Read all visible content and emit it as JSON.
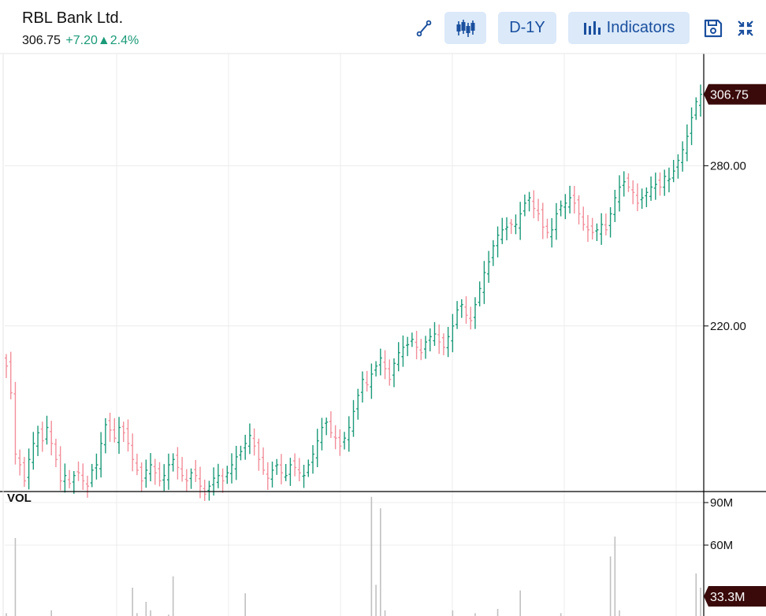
{
  "header": {
    "title": "RBL Bank Ltd.",
    "price": "306.75",
    "change": "+7.20",
    "change_pct": "2.4%",
    "change_arrow": "▲"
  },
  "toolbar": {
    "draw_icon": "line-draw-icon",
    "candles_icon": "candlestick-icon",
    "range_label": "D-1Y",
    "indicators_label": "Indicators",
    "indicators_icon": "bar-chart-icon",
    "save_icon": "save-icon",
    "collapse_icon": "collapse-icon"
  },
  "colors": {
    "up": "#1a9a78",
    "down": "#f28e9a",
    "accent": "#1a4f9e",
    "button_bg": "#dbe9f9",
    "last_price_bg": "#3a0a0a",
    "volume": "#c0c0c0"
  },
  "chart_data": {
    "type": "ohlc",
    "title": "RBL Bank Ltd.",
    "ylim": [
      158,
      322
    ],
    "yticks": [
      280,
      220
    ],
    "ytick_labels": [
      "280.00",
      "220.00"
    ],
    "last_price": 306.75,
    "last_price_label": "306.75",
    "grid": true,
    "closes": [
      205,
      195,
      172,
      168,
      162,
      170,
      176,
      180,
      177,
      182,
      176,
      170,
      162,
      164,
      161,
      164,
      165,
      162,
      160,
      166,
      168,
      176,
      183,
      181,
      178,
      182,
      180,
      176,
      170,
      166,
      162,
      166,
      168,
      165,
      162,
      164,
      168,
      170,
      167,
      164,
      162,
      165,
      164,
      160,
      157,
      160,
      163,
      164,
      162,
      165,
      168,
      171,
      173,
      176,
      179,
      175,
      170,
      166,
      163,
      166,
      168,
      165,
      164,
      168,
      167,
      165,
      164,
      168,
      172,
      177,
      182,
      184,
      180,
      178,
      175,
      178,
      182,
      188,
      194,
      200,
      198,
      202,
      205,
      208,
      204,
      200,
      206,
      210,
      212,
      213,
      215,
      212,
      210,
      214,
      216,
      217,
      214,
      212,
      216,
      220,
      226,
      228,
      224,
      222,
      228,
      234,
      240,
      244,
      250,
      254,
      256,
      257,
      258,
      258,
      262,
      266,
      268,
      264,
      262,
      257,
      255,
      256,
      262,
      265,
      266,
      268,
      266,
      262,
      258,
      256,
      255,
      256,
      258,
      256,
      262,
      268,
      272,
      274,
      272,
      270,
      266,
      268,
      270,
      272,
      273,
      272,
      276,
      275,
      278,
      282,
      286,
      291,
      298,
      304,
      306.75
    ],
    "volume": {
      "label": "VOL",
      "ylim": [
        0,
        100
      ],
      "yticks": [
        90,
        60
      ],
      "ytick_labels": [
        "90M",
        "60M"
      ],
      "last_label": "33.3M",
      "values": [
        12,
        8,
        65,
        10,
        6,
        4,
        9,
        5,
        3,
        4,
        14,
        7,
        3,
        2,
        5,
        8,
        3,
        4,
        2,
        3,
        5,
        2,
        6,
        4,
        3,
        2,
        7,
        3,
        30,
        12,
        5,
        20,
        14,
        9,
        7,
        6,
        11,
        38,
        8,
        4,
        6,
        3,
        2,
        5,
        9,
        4,
        3,
        6,
        2,
        3,
        8,
        5,
        2,
        26,
        9,
        3,
        5,
        2,
        4,
        6,
        3,
        5,
        8,
        3,
        4,
        2,
        3,
        6,
        4,
        2,
        5,
        3,
        7,
        9,
        4,
        3,
        6,
        10,
        5,
        8,
        4,
        94,
        32,
        86,
        14,
        9,
        6,
        4,
        5,
        7,
        3,
        2,
        8,
        6,
        4,
        3,
        5,
        9,
        4,
        14,
        6,
        3,
        2,
        5,
        12,
        4,
        3,
        7,
        4,
        15,
        8,
        6,
        4,
        3,
        28,
        10,
        5,
        6,
        3,
        2,
        8,
        4,
        3,
        12,
        7,
        4,
        2,
        3,
        6,
        8,
        4,
        10,
        5,
        3,
        52,
        66,
        14,
        9,
        6,
        3,
        4,
        7,
        3,
        2,
        8,
        5,
        4,
        3,
        10,
        6,
        8,
        4,
        3,
        40,
        30
      ]
    }
  }
}
